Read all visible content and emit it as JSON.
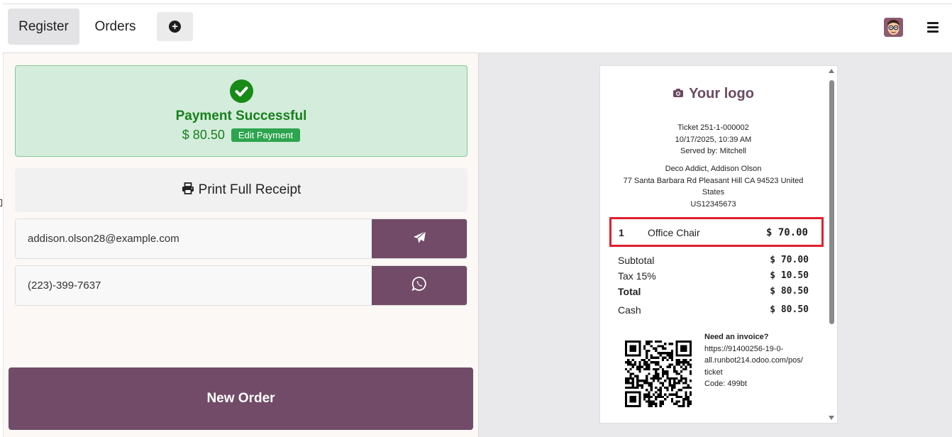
{
  "topbar": {
    "tabs": [
      {
        "label": "Register"
      },
      {
        "label": "Orders"
      }
    ],
    "add_symbol": "+",
    "avatar_icon": "user-avatar-icon",
    "menu_icon": "hamburger-icon"
  },
  "payment": {
    "title": "Payment Successful",
    "amount": "$ 80.50",
    "edit_label": "Edit Payment",
    "accent_color": "#16801b"
  },
  "actions": {
    "print_label": "Print Full Receipt",
    "email_value": "addison.olson28@example.com",
    "phone_value": "(223)-399-7637",
    "new_order_label": "New Order",
    "brand_color": "#714b67"
  },
  "receipt": {
    "logo_text": "Your logo",
    "ticket": "Ticket 251-1-000002",
    "datetime": "10/17/2025, 10:39 AM",
    "served_by": "Served by: Mitchell",
    "customer_name": "Deco Addict, Addison Olson",
    "customer_address": "77 Santa Barbara Rd Pleasant Hill CA 94523 United States",
    "customer_vat": "US12345673",
    "lines": [
      {
        "qty": "1",
        "product": "Office Chair",
        "price": "$ 70.00"
      }
    ],
    "totals": [
      {
        "label": "Subtotal",
        "value": "$ 70.00"
      },
      {
        "label": "Tax 15%",
        "value": "$ 10.50"
      },
      {
        "label": "Total",
        "value": "$ 80.50"
      },
      {
        "label": "Cash",
        "value": "$ 80.50"
      }
    ],
    "invoice": {
      "heading": "Need an invoice?",
      "url_1": "https://91400256-19-0-",
      "url_2": "all.runbot214.odoo.com/pos/",
      "url_3": "ticket",
      "code": "Code: 499bt"
    },
    "highlight_color": "#e0202c"
  }
}
